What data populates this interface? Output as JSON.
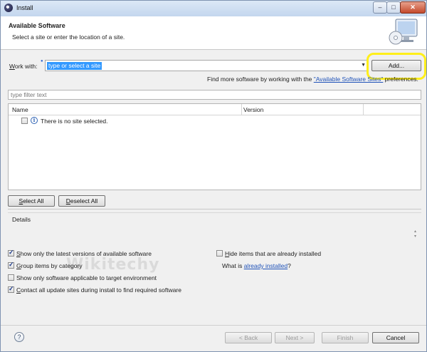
{
  "window": {
    "title": "Install"
  },
  "header": {
    "title": "Available Software",
    "subtitle": "Select a site or enter the location of a site."
  },
  "work_with": {
    "label_prefix": "W",
    "label_rest": "ork with:",
    "value": "type or select a site",
    "add_button": "Add...",
    "find_more_prefix": "Find more software by working with the ",
    "find_more_link": "\"Available Software Sites\"",
    "find_more_suffix": " preferences."
  },
  "filter": {
    "placeholder": "type filter text"
  },
  "table": {
    "columns": [
      "Name",
      "Version"
    ],
    "empty_message": "There is no site selected."
  },
  "selection_buttons": {
    "select_all_ul": "S",
    "select_all_rest": "elect All",
    "deselect_all_ul": "D",
    "deselect_all_rest": "eselect All"
  },
  "details": {
    "label": "Details"
  },
  "options": {
    "latest_versions": {
      "ul": "S",
      "rest": "how only the latest versions of available software",
      "checked": true
    },
    "hide_installed": {
      "ul": "H",
      "rest": "ide items that are already installed",
      "checked": false
    },
    "group_by_category": {
      "ul": "G",
      "rest": "roup items by category",
      "checked": true
    },
    "what_is_prefix": "What is ",
    "already_installed_link": "already installed",
    "what_is_suffix": "?",
    "applicable_only": {
      "text": "Show only software applicable to target environment",
      "checked": false
    },
    "contact_sites": {
      "ul": "C",
      "rest": "ontact all update sites during install to find required software",
      "checked": true
    }
  },
  "watermark": "Wikitechy",
  "footer": {
    "back": "< Back",
    "next": "Next >",
    "finish": "Finish",
    "cancel": "Cancel"
  },
  "colors": {
    "highlight": "#ffef1a",
    "selection": "#3399ff",
    "link": "#1f52b8"
  },
  "icons": [
    "eclipse-icon",
    "monitor-cd-icon",
    "info-icon",
    "help-icon",
    "dropdown-arrow-icon"
  ]
}
